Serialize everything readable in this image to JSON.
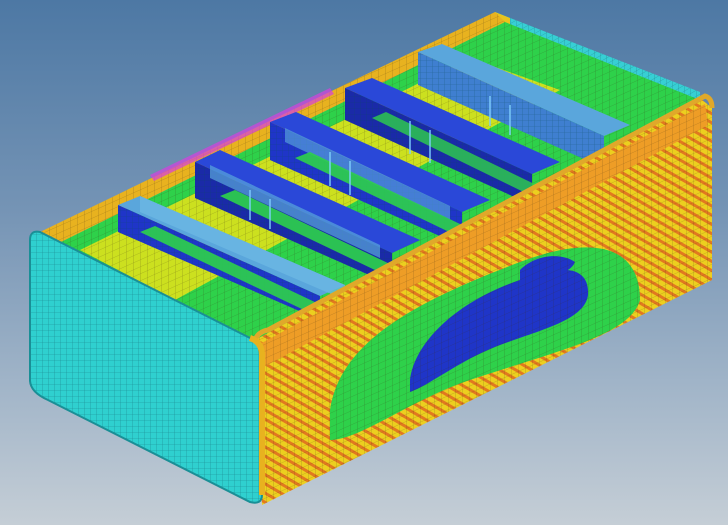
{
  "viewport": {
    "background_top": "#4d78a4",
    "background_bottom": "#c5ced6"
  },
  "model": {
    "subject": "fea-mesh-open-box-tray",
    "colors": {
      "cyan": "#2fd0cf",
      "cyan_dark": "#22b4b8",
      "light_blue": "#5aa6dc",
      "blue": "#1f35c8",
      "navy": "#1a2aa8",
      "green": "#2ed14a",
      "yellow": "#e8e317",
      "orange": "#eea326",
      "red": "#d8331f",
      "magenta": "#d63ee0"
    }
  }
}
